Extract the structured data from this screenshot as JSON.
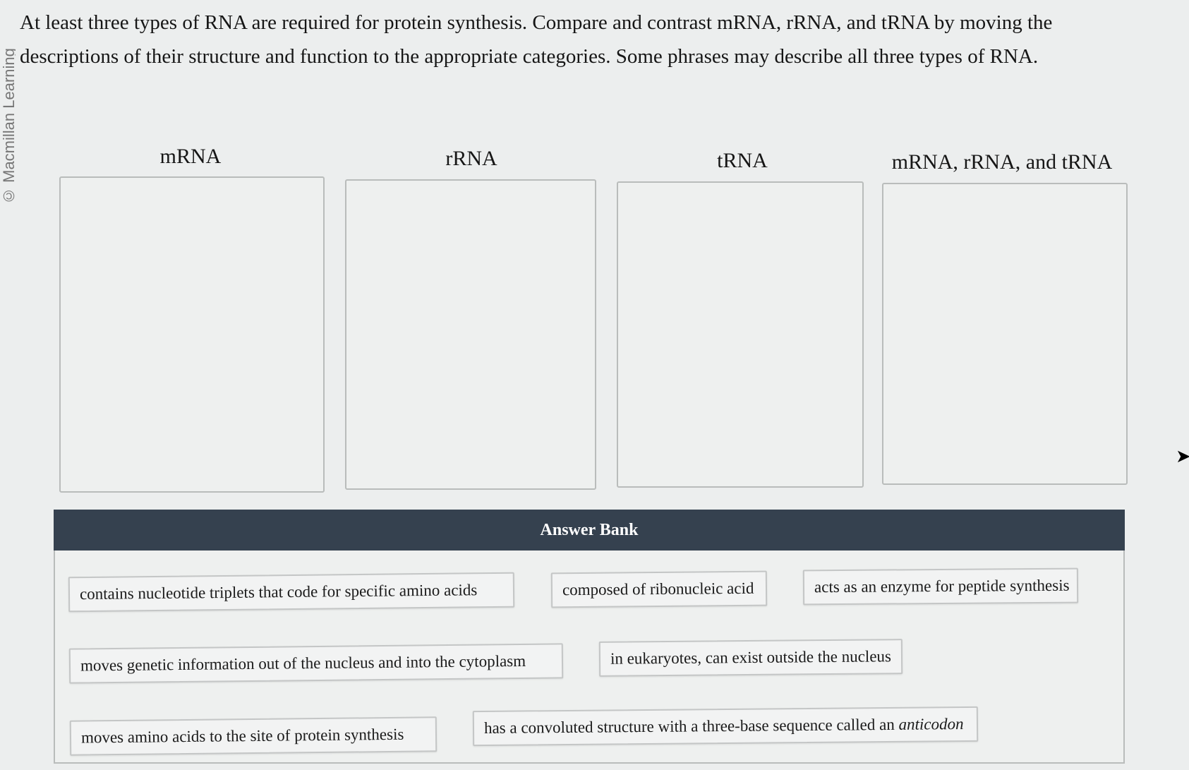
{
  "watermark": "© Macmillan Learning",
  "question": "At least three types of RNA are required for protein synthesis. Compare and contrast mRNA, rRNA, and tRNA by moving the descriptions of their structure and function to the appropriate categories. Some phrases may describe all three types of RNA.",
  "categories": [
    {
      "label": "mRNA"
    },
    {
      "label": "rRNA"
    },
    {
      "label": "tRNA"
    },
    {
      "label": "mRNA, rRNA, and tRNA"
    }
  ],
  "answer_bank": {
    "title": "Answer Bank",
    "items": [
      "contains nucleotide triplets that code for specific amino acids",
      "composed of ribonucleic acid",
      "acts as an enzyme for peptide synthesis",
      "moves genetic information out of the nucleus and into the cytoplasm",
      "in eukaryotes, can exist outside the nucleus",
      "moves amino acids to the site of protein synthesis",
      "has a convoluted structure with a three-base sequence called an",
      "anticodon"
    ]
  }
}
